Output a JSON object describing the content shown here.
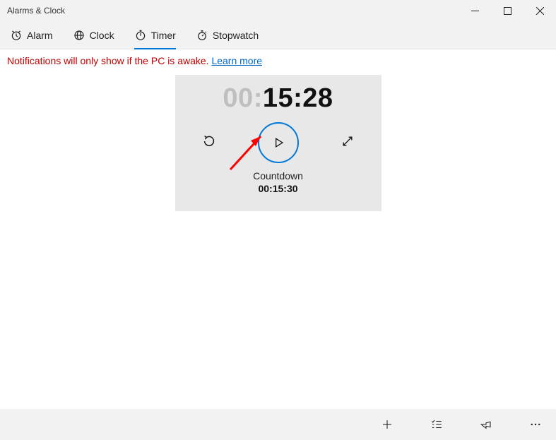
{
  "window": {
    "title": "Alarms & Clock"
  },
  "tabs": {
    "items": [
      {
        "label": "Alarm",
        "icon": "alarm-icon"
      },
      {
        "label": "Clock",
        "icon": "worldclock-icon"
      },
      {
        "label": "Timer",
        "icon": "timer-icon"
      },
      {
        "label": "Stopwatch",
        "icon": "stopwatch-icon"
      }
    ],
    "active_index": 2
  },
  "notification": {
    "text": "Notifications will only show if the PC is awake. ",
    "link_text": "Learn more"
  },
  "timer": {
    "hours_display": "00",
    "mmss_display": "15:28",
    "name": "Countdown",
    "original_time": "00:15:30"
  },
  "commandbar": {
    "add": "Add",
    "edit": "Edit timers",
    "pin": "Pin",
    "more": "More"
  }
}
